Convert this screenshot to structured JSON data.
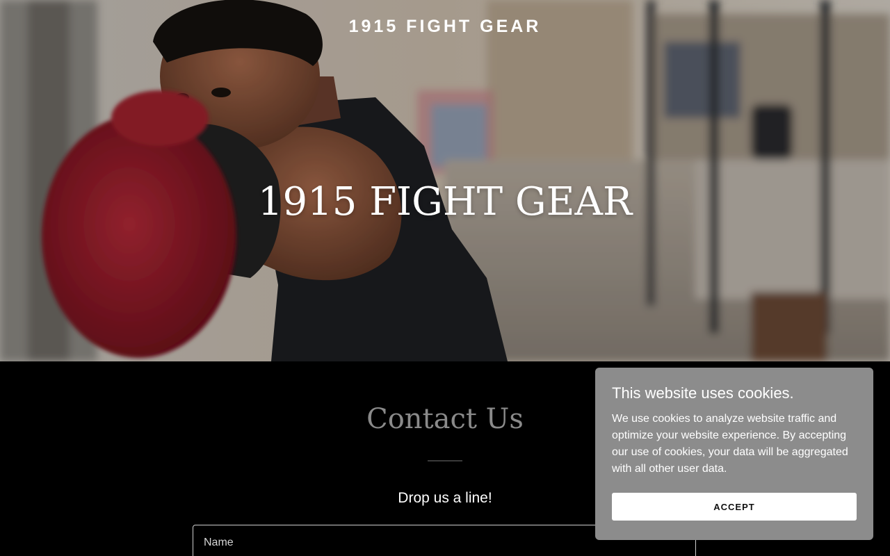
{
  "header": {
    "site_title": "1915 FIGHT GEAR"
  },
  "hero": {
    "heading": "1915 FIGHT GEAR",
    "image_subject": "boxer-punching-with-red-glove"
  },
  "contact": {
    "title": "Contact Us",
    "subtitle": "Drop us a line!",
    "name_placeholder": "Name"
  },
  "cookie_banner": {
    "title": "This website uses cookies.",
    "text": "We use cookies to analyze website traffic and optimize your website experience. By accepting our use of cookies, your data will be aggregated with all other user data.",
    "accept_label": "ACCEPT"
  },
  "colors": {
    "page_background": "#000000",
    "cookie_background": "#8c8c8c",
    "contact_title": "#8a8a8a",
    "glove_red": "#9e1b2a"
  }
}
